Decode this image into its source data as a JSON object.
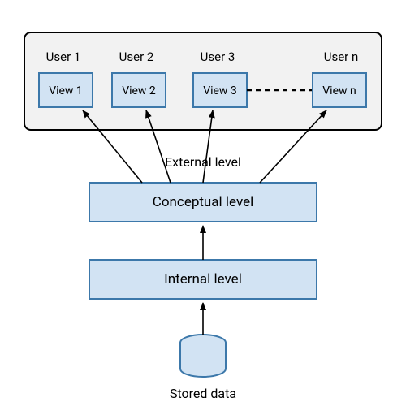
{
  "external": {
    "label": "External level",
    "users": [
      {
        "user": "User 1",
        "view": "View 1"
      },
      {
        "user": "User 2",
        "view": "View 2"
      },
      {
        "user": "User 3",
        "view": "View 3"
      },
      {
        "user": "User n",
        "view": "View n"
      }
    ]
  },
  "conceptual": {
    "label": "Conceptual level"
  },
  "internal": {
    "label": "Internal level"
  },
  "storage": {
    "label": "Stored data"
  },
  "colors": {
    "panel_fill": "#f2f2f2",
    "panel_stroke": "#000000",
    "box_fill": "#d2e3f3",
    "box_stroke": "#3c78aa",
    "arrow": "#000000"
  }
}
